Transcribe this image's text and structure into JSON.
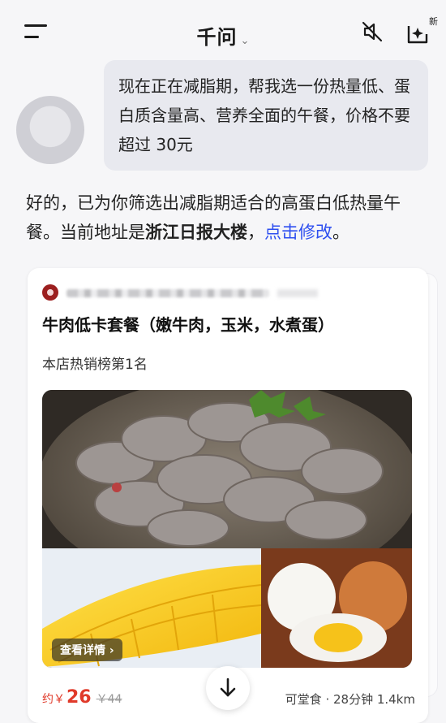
{
  "header": {
    "title": "千问",
    "new_badge": "新"
  },
  "icons": {
    "menu": "menu-icon",
    "chevron": "chevron-down-icon",
    "mute": "speaker-muted-icon",
    "new_chat": "new-chat-sparkle-icon",
    "scroll_down": "arrow-down-icon"
  },
  "user_message": {
    "text": "现在正在减脂期，帮我选一份热量低、蛋白质含量高、营养全面的午餐，价格不要超过 30元"
  },
  "assistant_message": {
    "intro": "好的，已为你筛选出减脂期适合的高蛋白低热量午餐。当前地址是",
    "address": "浙江日报大楼",
    "separator": "，",
    "edit_link": "点击修改",
    "end": "。"
  },
  "product_card": {
    "title": "牛肉低卡套餐（嫩牛肉，玉米，水煮蛋）",
    "rank": "本店热销榜第1名",
    "details_button": "查看详情 ›",
    "price_prefix": "约￥",
    "price": "26",
    "original_price": "￥44",
    "delivery_info": "可堂食 · 28分钟  1.4km"
  },
  "colors": {
    "accent_link": "#2e4ff0",
    "price_red": "#e03a2a",
    "bubble_bg": "#e8e9ef",
    "page_bg": "#f6f6f8"
  }
}
